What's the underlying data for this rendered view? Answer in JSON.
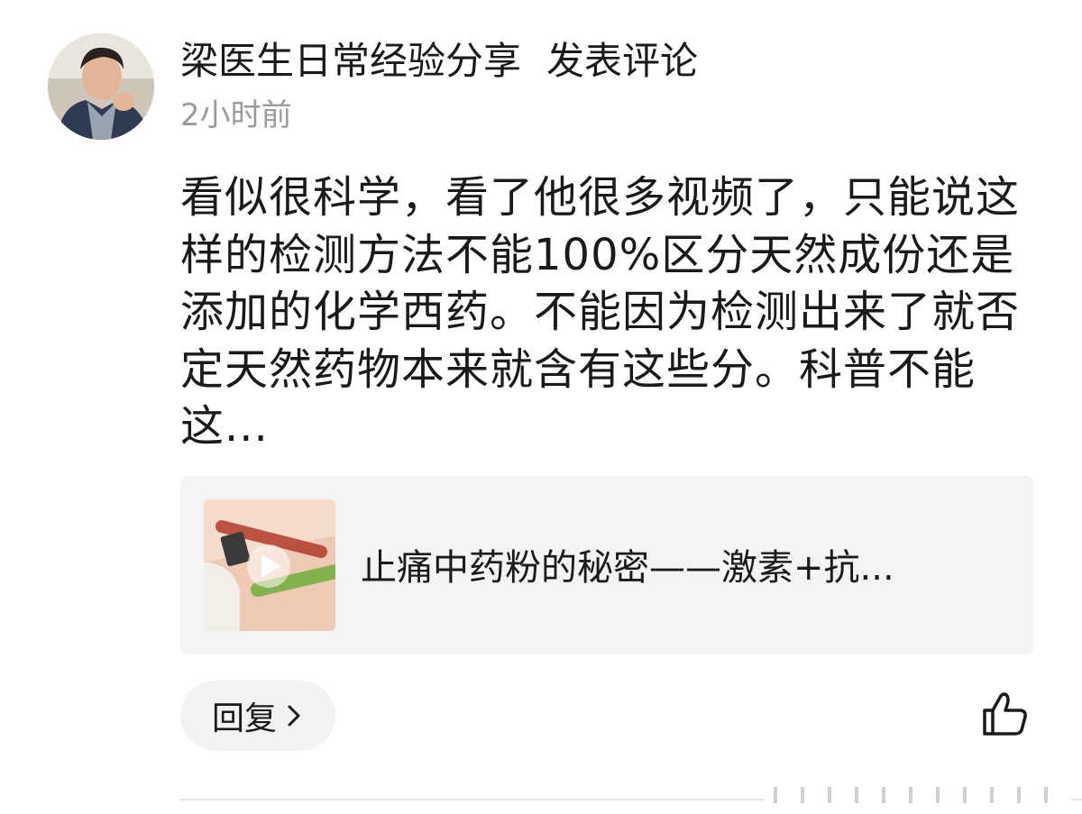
{
  "comment": {
    "author": "梁医生日常经验分享",
    "action": "发表评论",
    "timestamp": "2小时前",
    "text": "看似很科学，看了他很多视频了，只能说这样的检测方法不能100%区分天然成份还是添加的化学西药。不能因为检测出来了就否定天然药物本来就含有这些分。科普不能这..."
  },
  "video": {
    "title": "止痛中药粉的秘密——激素+抗..."
  },
  "actions": {
    "reply_label": "回复"
  },
  "icons": {
    "avatar": "profile-photo",
    "play": "play-icon",
    "chevron": "chevron-right-icon",
    "like": "thumbs-up-icon"
  },
  "colors": {
    "text": "#1a1a1a",
    "muted": "#9b9b9b",
    "card_bg": "#f4f4f6",
    "button_bg": "#f3f3f5"
  }
}
